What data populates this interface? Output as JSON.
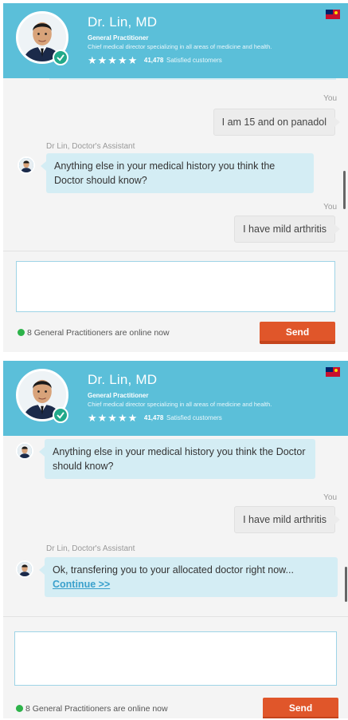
{
  "doctor": {
    "name": "Dr. Lin, MD",
    "title": "General Practitioner",
    "description": "Chief medical director specializing in all areas of medicine and health.",
    "stars": "★★★★★",
    "customer_count": "41,478",
    "customer_label": "Satisfied customers"
  },
  "panel1": {
    "messages": [
      {
        "sender": "You",
        "text": "I am 15 and on panadol"
      },
      {
        "sender": "Dr Lin, Doctor's Assistant",
        "text": "Anything else in your medical history you think the Doctor should know?"
      },
      {
        "sender": "You",
        "text": "I have mild arthritis"
      }
    ]
  },
  "panel2": {
    "messages": [
      {
        "text": "Anything else in your medical history you think the Doctor should know?"
      },
      {
        "sender": "You",
        "text": "I have mild arthritis"
      },
      {
        "sender": "Dr Lin, Doctor's Assistant",
        "text": "Ok, transfering you to your allocated doctor right now...",
        "link": "Continue >>"
      }
    ]
  },
  "composer": {
    "online_text": "8 General Practitioners are online now",
    "send_label": "Send"
  },
  "colors": {
    "header": "#5bbfd9",
    "bot_bubble": "#d4edf4",
    "user_bubble": "#ececec",
    "send_button": "#e0562a",
    "online_dot": "#2db34a"
  },
  "icons": {
    "verified": "check-shield-icon",
    "flag": "australia-flag-icon"
  }
}
